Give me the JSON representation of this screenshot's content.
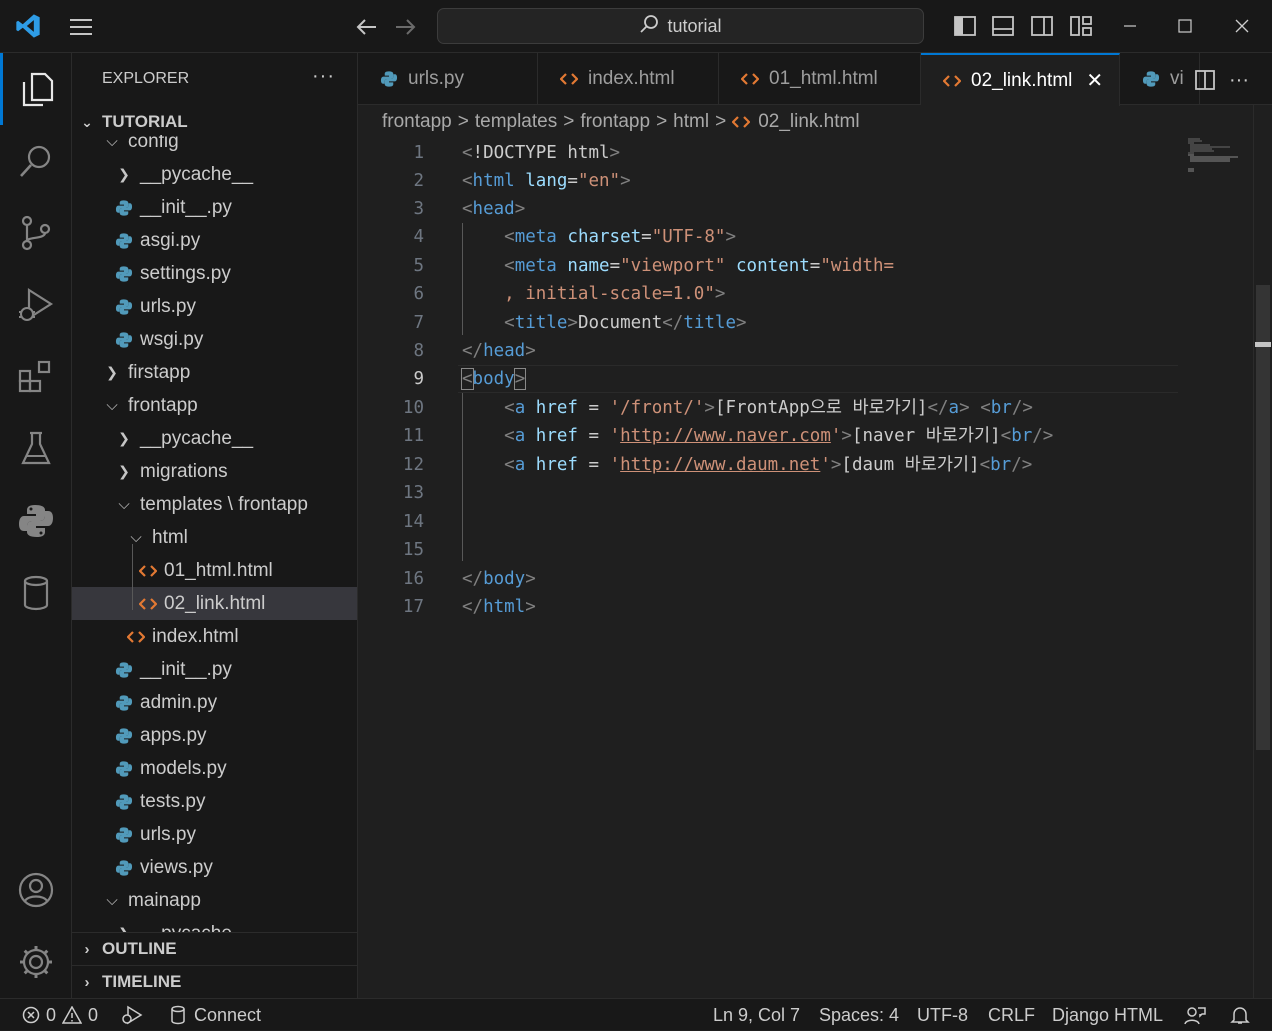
{
  "window": {
    "search_text": "tutorial"
  },
  "explorer": {
    "title": "EXPLORER",
    "more": "···",
    "section": "TUTORIAL",
    "tree": [
      {
        "label": "config",
        "type": "folder-open",
        "level": 1
      },
      {
        "label": "__pycache__",
        "type": "folder",
        "level": 2
      },
      {
        "label": "__init__.py",
        "type": "py",
        "level": 2
      },
      {
        "label": "asgi.py",
        "type": "py",
        "level": 2
      },
      {
        "label": "settings.py",
        "type": "py",
        "level": 2
      },
      {
        "label": "urls.py",
        "type": "py",
        "level": 2
      },
      {
        "label": "wsgi.py",
        "type": "py",
        "level": 2
      },
      {
        "label": "firstapp",
        "type": "folder",
        "level": 1
      },
      {
        "label": "frontapp",
        "type": "folder-open",
        "level": 1
      },
      {
        "label": "__pycache__",
        "type": "folder",
        "level": 2
      },
      {
        "label": "migrations",
        "type": "folder",
        "level": 2
      },
      {
        "label": "templates \\ frontapp",
        "type": "folder-open",
        "level": 2
      },
      {
        "label": "html",
        "type": "folder-open",
        "level": 3
      },
      {
        "label": "01_html.html",
        "type": "html",
        "level": 4
      },
      {
        "label": "02_link.html",
        "type": "html",
        "level": 4,
        "selected": true
      },
      {
        "label": "index.html",
        "type": "html",
        "level": 3
      },
      {
        "label": "__init__.py",
        "type": "py",
        "level": 2
      },
      {
        "label": "admin.py",
        "type": "py",
        "level": 2
      },
      {
        "label": "apps.py",
        "type": "py",
        "level": 2
      },
      {
        "label": "models.py",
        "type": "py",
        "level": 2
      },
      {
        "label": "tests.py",
        "type": "py",
        "level": 2
      },
      {
        "label": "urls.py",
        "type": "py",
        "level": 2
      },
      {
        "label": "views.py",
        "type": "py",
        "level": 2
      },
      {
        "label": "mainapp",
        "type": "folder-open",
        "level": 1
      },
      {
        "label": "__pycache__",
        "type": "folder",
        "level": 2
      }
    ],
    "outline": "OUTLINE",
    "timeline": "TIMELINE"
  },
  "tabs": [
    {
      "label": "urls.py",
      "icon": "python-icon"
    },
    {
      "label": "index.html",
      "icon": "html-icon"
    },
    {
      "label": "01_html.html",
      "icon": "html-icon"
    },
    {
      "label": "02_link.html",
      "icon": "html-icon",
      "active": true
    },
    {
      "label": "vi",
      "icon": "python-icon"
    }
  ],
  "breadcrumb": [
    "frontapp",
    "templates",
    "frontapp",
    "html",
    "02_link.html"
  ],
  "editor": {
    "current_line": 9,
    "line_numbers": [
      "1",
      "2",
      "3",
      "4",
      "5",
      "6",
      "7",
      "8",
      "9",
      "10",
      "11",
      "12",
      "13",
      "14",
      "15",
      "16",
      "17"
    ]
  },
  "status": {
    "errors": "0",
    "warnings": "0",
    "connect": "Connect",
    "position": "Ln 9, Col 7",
    "spaces": "Spaces: 4",
    "encoding": "UTF-8",
    "eol": "CRLF",
    "language": "Django HTML"
  },
  "colors": {
    "accent": "#0078d4",
    "html_icon": "#e37933",
    "python_icon": "#519aba",
    "tag": "#569cd6",
    "attr": "#9cdcfe",
    "string": "#ce9178"
  }
}
